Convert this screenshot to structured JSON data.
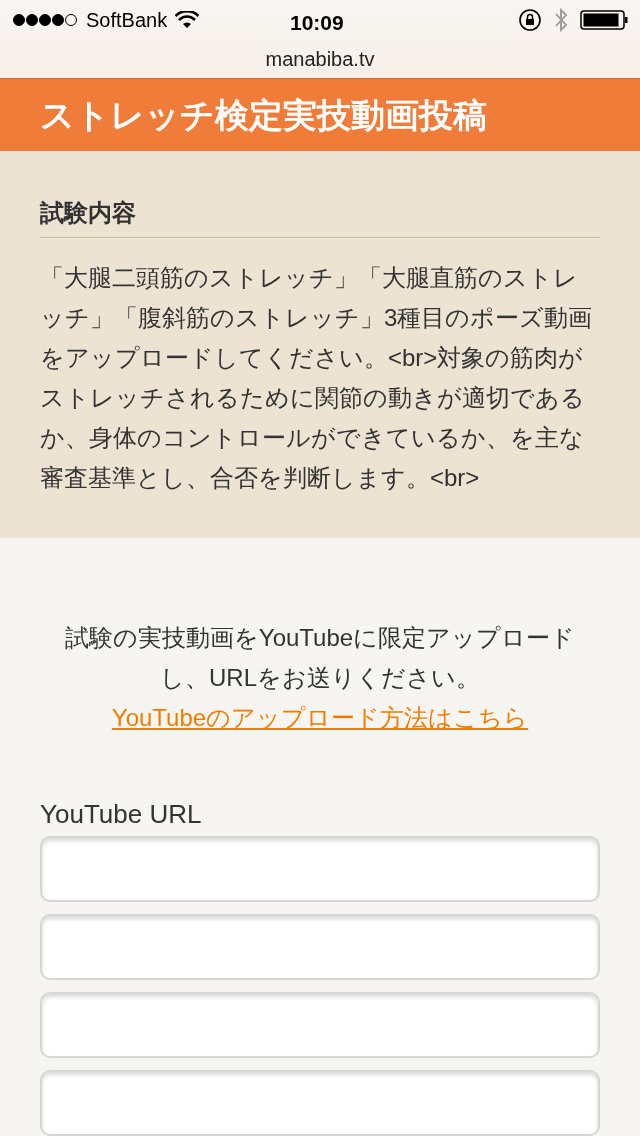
{
  "status_bar": {
    "carrier": "SoftBank",
    "time": "10:09"
  },
  "address_bar": {
    "url": "manabiba.tv"
  },
  "header": {
    "title": "ストレッチ検定実技動画投稿"
  },
  "exam": {
    "heading": "試験内容",
    "body": "「大腿二頭筋のストレッチ」「大腿直筋のストレッチ」「腹斜筋のストレッチ」3種目のポーズ動画をアップロードしてください。<br>対象の筋肉がストレッチされるために関節の動きが適切であるか、身体のコントロールができているか、を主な審査基準とし、合否を判断します。<br>"
  },
  "intro": {
    "text": "試験の実技動画をYouTubeに限定アップロードし、URLをお送りください。",
    "link": "YouTubeのアップロード方法はこちら"
  },
  "form": {
    "label": "YouTube URL",
    "fields": [
      {
        "kind": "text"
      },
      {
        "kind": "text"
      },
      {
        "kind": "text"
      },
      {
        "kind": "text"
      }
    ]
  }
}
